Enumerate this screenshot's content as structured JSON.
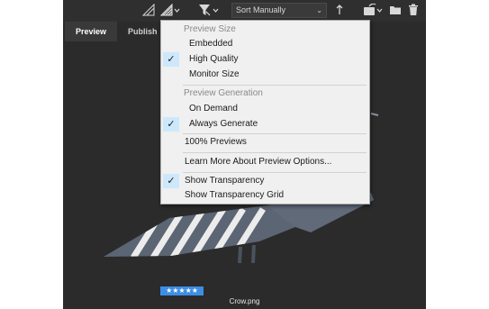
{
  "toolbar": {
    "sort_value": "Sort Manually",
    "icons": [
      "quality-low-icon",
      "quality-high-icon",
      "filter-icon",
      "sort-direction-icon",
      "rotate-icon",
      "folder-icon",
      "trash-icon"
    ]
  },
  "tabs": [
    {
      "label": "Preview",
      "active": true
    },
    {
      "label": "Publish",
      "active": false
    }
  ],
  "menu": {
    "items": [
      {
        "label": "Preview Size",
        "type": "header"
      },
      {
        "label": "Embedded",
        "checked": false
      },
      {
        "label": "High Quality",
        "checked": true
      },
      {
        "label": "Monitor Size",
        "checked": false
      },
      {
        "label": "Preview Generation",
        "type": "header"
      },
      {
        "label": "On Demand",
        "checked": false
      },
      {
        "label": "Always Generate",
        "checked": true
      },
      {
        "label": "100% Previews",
        "checked": false
      },
      {
        "label": "Learn More About Preview Options...",
        "checked": false
      },
      {
        "label": "Show Transparency",
        "checked": true
      },
      {
        "label": "Show Transparency Grid",
        "checked": false
      }
    ]
  },
  "preview": {
    "filename": "Crow.png",
    "rating": "★★★★★"
  },
  "colors": {
    "app_bg": "#2b2b2b",
    "menu_bg": "#f0f0f0",
    "check_bg": "#cde8fb",
    "rating_bg": "#3c8ee6"
  }
}
